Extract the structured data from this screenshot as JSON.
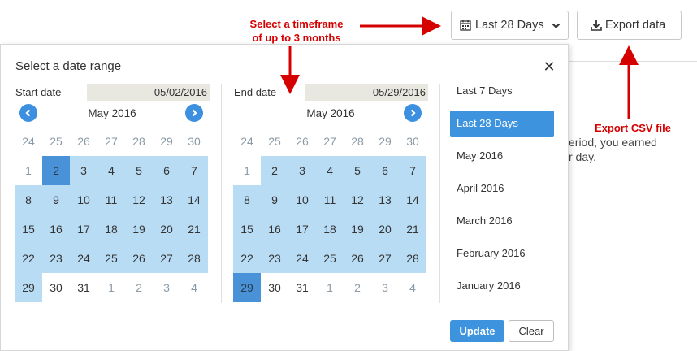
{
  "background": {
    "summary_line1": "eriod, you earned",
    "summary_line2": "r day."
  },
  "toolbar": {
    "range_label": "Last 28 Days",
    "export_label": "Export data"
  },
  "annotations": {
    "timeframe_line1": "Select a timeframe",
    "timeframe_line2": "of up to 3 months",
    "export_note": "Export CSV file"
  },
  "picker": {
    "title": "Select a date range",
    "start": {
      "label": "Start date",
      "value": "05/02/2016",
      "month": "May 2016"
    },
    "end": {
      "label": "End date",
      "value": "05/29/2016",
      "month": "May 2016"
    },
    "weeks": [
      [
        "24",
        "25",
        "26",
        "27",
        "28",
        "29",
        "30"
      ],
      [
        "1",
        "2",
        "3",
        "4",
        "5",
        "6",
        "7"
      ],
      [
        "8",
        "9",
        "10",
        "11",
        "12",
        "13",
        "14"
      ],
      [
        "15",
        "16",
        "17",
        "18",
        "19",
        "20",
        "21"
      ],
      [
        "22",
        "23",
        "24",
        "25",
        "26",
        "27",
        "28"
      ],
      [
        "29",
        "30",
        "31",
        "1",
        "2",
        "3",
        "4"
      ]
    ],
    "presets": [
      "Last 7 Days",
      "Last 28 Days",
      "May 2016",
      "April 2016",
      "March 2016",
      "February 2016",
      "January 2016"
    ],
    "active_preset": "Last 28 Days",
    "update_label": "Update",
    "clear_label": "Clear"
  },
  "colors": {
    "accent": "#3d93dd",
    "range_fill": "#b9dcf5",
    "annotation_red": "#d50000"
  }
}
